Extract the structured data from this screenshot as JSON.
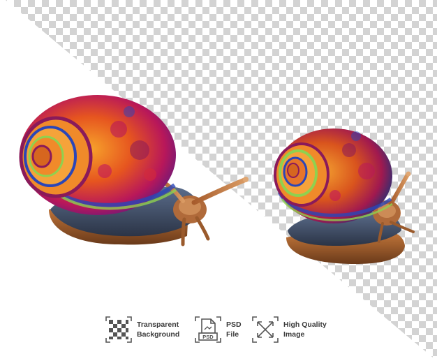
{
  "scene": {
    "subject": "two snails",
    "background": "transparency checkerboard (white lower-left)"
  },
  "badges": [
    {
      "icon": "transparent-grid-icon",
      "line1": "Transparent",
      "line2": "Background"
    },
    {
      "icon": "psd-file-icon",
      "line1": "PSD",
      "line2": "File",
      "tag": "PSD"
    },
    {
      "icon": "high-quality-arrows-icon",
      "line1": "High Quality",
      "line2": "Image"
    }
  ],
  "colors": {
    "checker_light": "#ffffff",
    "checker_dark": "#d3d3d3",
    "shell_orange": "#f06a1c",
    "shell_magenta": "#c2185b",
    "shell_blue": "#2a46b8",
    "shell_green": "#8fd14f",
    "body_slate": "#3e4f6a",
    "tentacle_brown": "#b06a3a",
    "icon_color": "#555555",
    "label_color": "#3a3a3a"
  }
}
